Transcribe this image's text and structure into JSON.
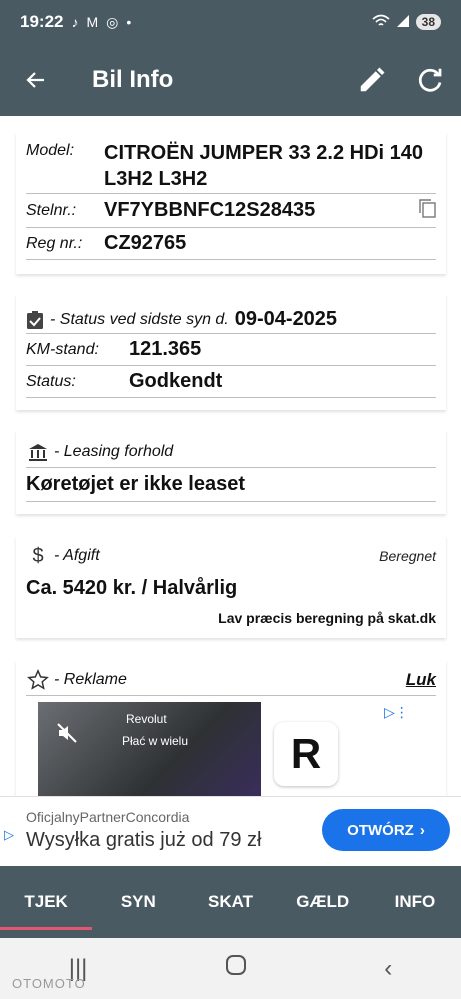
{
  "status_bar": {
    "time": "19:22",
    "icons": [
      "tiktok-icon",
      "gmail-icon",
      "chrome-icon",
      "dot-icon"
    ],
    "battery": "38"
  },
  "app_bar": {
    "title": "Bil Info"
  },
  "vehicle": {
    "model_label": "Model:",
    "model_value": "CITROËN JUMPER 33 2.2 HDi 140 L3H2 L3H2",
    "stelnr_label": "Stelnr.:",
    "stelnr_value": "VF7YBBNFC12S28435",
    "regnr_label": "Reg nr.:",
    "regnr_value": "CZ92765"
  },
  "syn": {
    "status_label": "- Status ved sidste syn d.",
    "status_date": "09-04-2025",
    "km_label": "KM-stand:",
    "km_value": "121.365",
    "state_label": "Status:",
    "state_value": "Godkendt"
  },
  "leasing": {
    "label": "- Leasing forhold",
    "value": "Køretøjet er ikke leaset"
  },
  "afgift": {
    "label": "- Afgift",
    "right_label": "Beregnet",
    "value": "Ca. 5420 kr. / Halvårlig",
    "link": "Lav præcis beregning på skat.dk"
  },
  "reklame": {
    "label": "- Reklame",
    "close": "Luk",
    "ad_brand": "Revolut",
    "ad_text": "Płać w wielu"
  },
  "ad_banner": {
    "advertiser": "OficjalnyPartnerConcordia",
    "headline": "Wysyłka gratis już od 79 zł",
    "cta": "OTWÓRZ"
  },
  "bottom_nav": {
    "tabs": [
      "TJEK",
      "SYN",
      "SKAT",
      "GÆLD",
      "INFO"
    ],
    "active": "TJEK"
  },
  "watermark": "OTOMOTO",
  "colors": {
    "bar": "#4a5a63",
    "accent": "#e0576f",
    "cta": "#1a73e8"
  }
}
